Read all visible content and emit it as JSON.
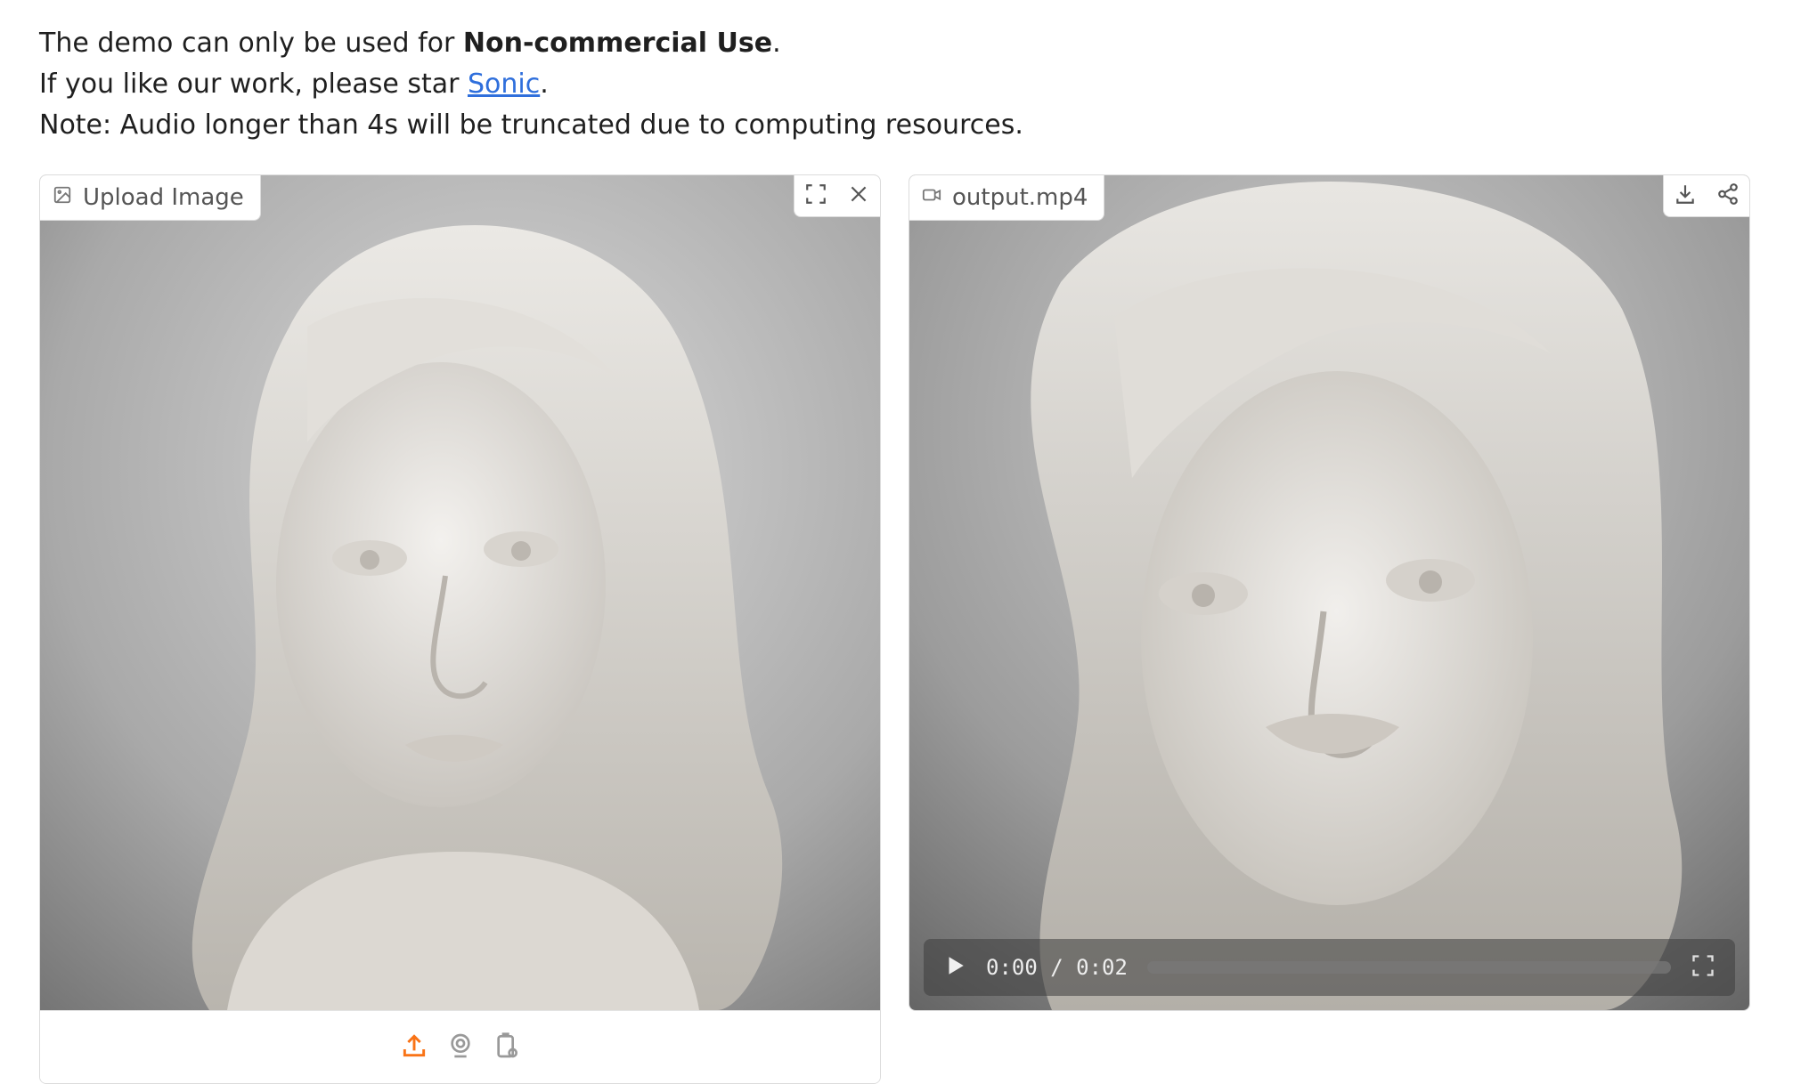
{
  "intro": {
    "line1_prefix": "The demo can only be used for ",
    "line1_bold": "Non-commercial Use",
    "line1_suffix": ".",
    "line2_prefix": "If you like our work, please star ",
    "line2_link": "Sonic",
    "line2_suffix": ".",
    "line3": "Note: Audio longer than 4s will be truncated due to computing resources."
  },
  "image_panel": {
    "label": "Upload Image",
    "label_icon": "image-icon",
    "actions": [
      "fullscreen-icon",
      "close-icon"
    ],
    "toolbar": [
      "upload-icon",
      "webcam-icon",
      "clipboard-icon"
    ]
  },
  "video_panel": {
    "label": "output.mp4",
    "label_icon": "video-icon",
    "actions": [
      "download-icon",
      "share-icon"
    ],
    "current_time": "0:00",
    "separator": " / ",
    "duration": "0:02",
    "progress": 0
  },
  "colors": {
    "link": "#2f6fdc",
    "accent_orange": "#f97316"
  }
}
